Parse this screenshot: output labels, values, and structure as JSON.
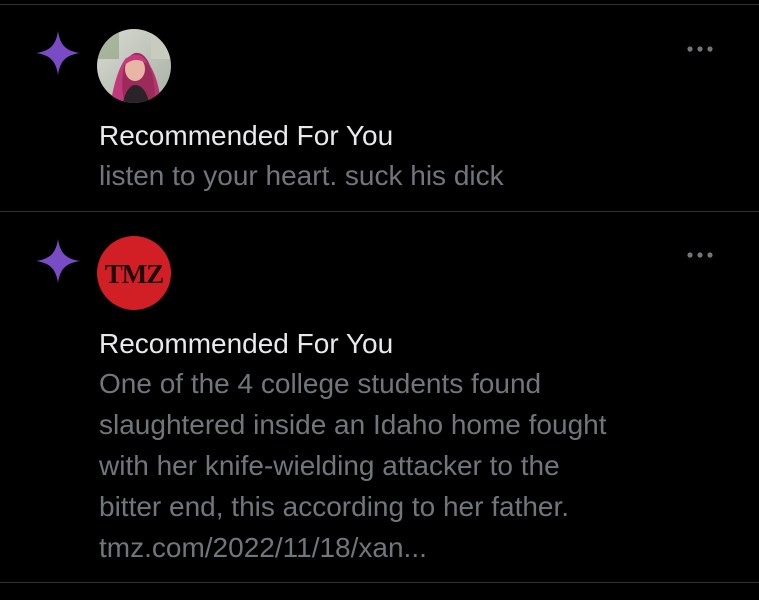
{
  "theme": {
    "background": "#000000",
    "divider": "#2f3336",
    "sparkle_color": "#794bc4",
    "heading_color": "#e7e9ea",
    "secondary_text": "#71767b",
    "tmz_red": "#d21f26"
  },
  "notifications": [
    {
      "type_icon": "sparkle-icon",
      "avatar": "user-profile-photo",
      "heading": "Recommended For You",
      "body_lines": [
        "listen to your heart. suck his dick"
      ]
    },
    {
      "type_icon": "sparkle-icon",
      "avatar": "tmz-logo",
      "avatar_text": "TMZ",
      "heading": "Recommended For You",
      "body_lines": [
        "One of the 4 college students found",
        "slaughtered inside an Idaho home fought",
        "with her knife-wielding attacker to the",
        "bitter end, this according to her father.",
        "tmz.com/2022/11/18/xan..."
      ]
    }
  ]
}
